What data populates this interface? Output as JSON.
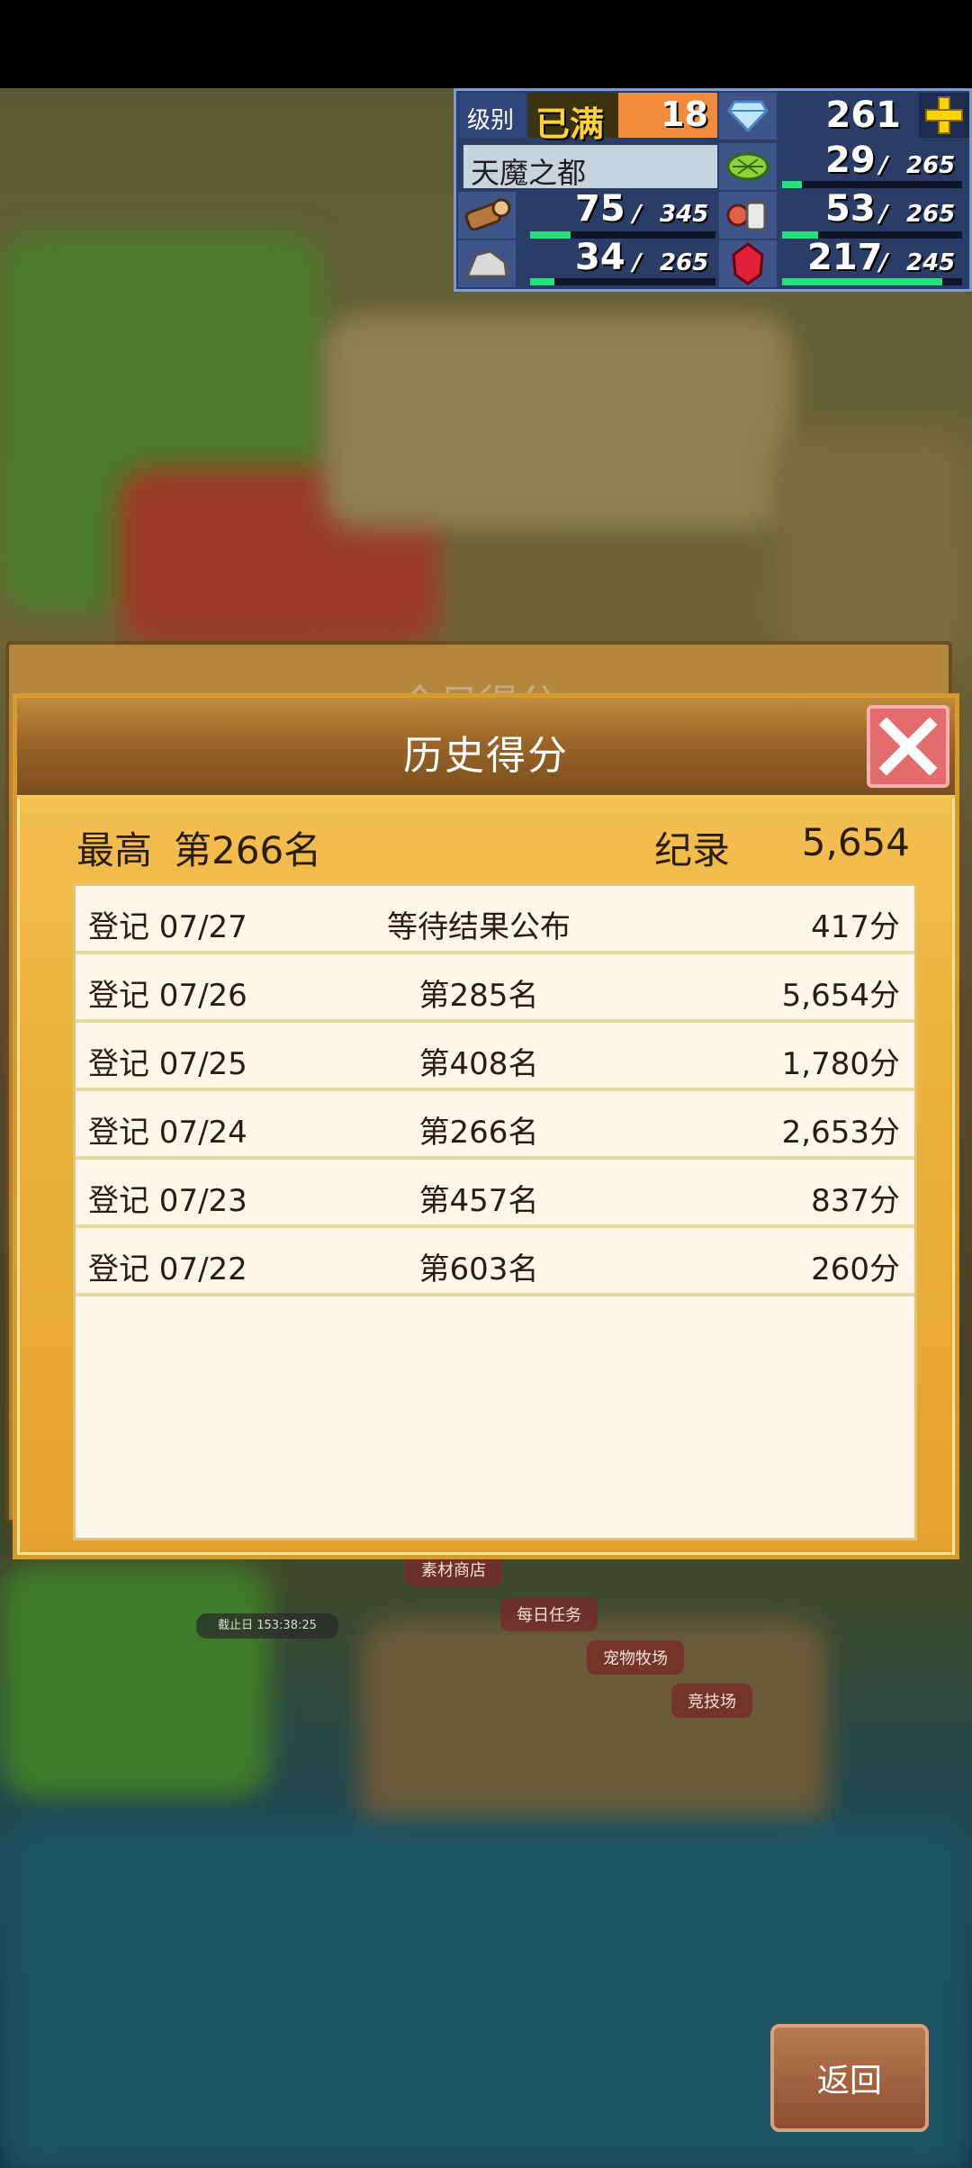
{
  "hud": {
    "level_label": "级别",
    "level_badge": "已满",
    "level_value": "18",
    "gems": "261",
    "city_name": "天魔之都",
    "grass": {
      "current": "29",
      "max": "265",
      "fill": 0.11
    },
    "wood": {
      "current": "75",
      "max": "345",
      "fill": 0.22
    },
    "food": {
      "current": "53",
      "max": "265",
      "fill": 0.2
    },
    "ore": {
      "current": "34",
      "max": "265",
      "fill": 0.13
    },
    "ruby": {
      "current": "217",
      "max": "245",
      "fill": 0.89
    }
  },
  "back_panel": {
    "title": "今日得分"
  },
  "dialog": {
    "title": "历史得分",
    "best_label": "最高",
    "best_rank": "第266名",
    "record_label": "纪录",
    "record_value": "5,654",
    "rows": [
      {
        "date": "登记 07/27",
        "rank": "等待结果公布",
        "score": "417分"
      },
      {
        "date": "登记 07/26",
        "rank": "第285名",
        "score": "5,654分"
      },
      {
        "date": "登记 07/25",
        "rank": "第408名",
        "score": "1,780分"
      },
      {
        "date": "登记 07/24",
        "rank": "第266名",
        "score": "2,653分"
      },
      {
        "date": "登记 07/23",
        "rank": "第457名",
        "score": "837分"
      },
      {
        "date": "登记 07/22",
        "rank": "第603名",
        "score": "260分"
      }
    ]
  },
  "map_labels": {
    "material_shop": "素材商店",
    "daily_tasks": "每日任务",
    "pet_ranch": "宠物牧场",
    "arena": "竞技场",
    "deadline": "截止日 153:38:25"
  },
  "back_button": "返回",
  "colors": {
    "bar_fill": "#26e27a",
    "dialog_gold": "#eeb23e",
    "close_red": "#e36b6b"
  }
}
